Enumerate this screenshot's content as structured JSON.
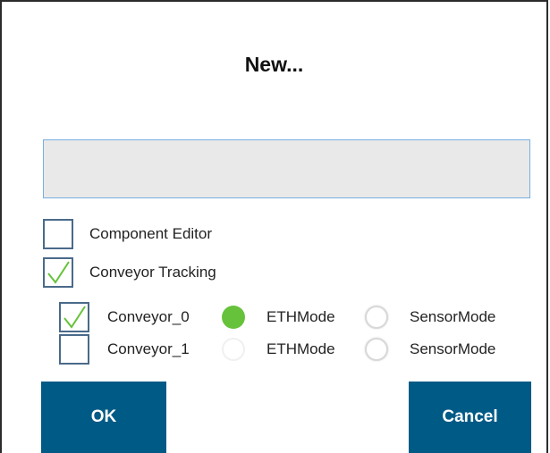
{
  "dialog": {
    "title": "New...",
    "name_input": {
      "value": "",
      "placeholder": ""
    }
  },
  "options": [
    {
      "label": "Component Editor",
      "checked": false
    },
    {
      "label": "Conveyor Tracking",
      "checked": true
    }
  ],
  "conveyors": [
    {
      "label": "Conveyor_0",
      "checked": true,
      "mode_a": "ETHMode",
      "mode_b": "SensorMode",
      "selected": "ETHMode"
    },
    {
      "label": "Conveyor_1",
      "checked": false,
      "mode_a": "ETHMode",
      "mode_b": "SensorMode",
      "selected": ""
    }
  ],
  "buttons": {
    "ok": "OK",
    "cancel": "Cancel"
  },
  "colors": {
    "accent": "#005a86",
    "check": "#66c23a",
    "checkbox_border": "#4a6a8a",
    "input_border": "#78aee0",
    "input_bg": "#e9e9e9"
  },
  "icons": {
    "checkmark": "checkmark-icon"
  }
}
